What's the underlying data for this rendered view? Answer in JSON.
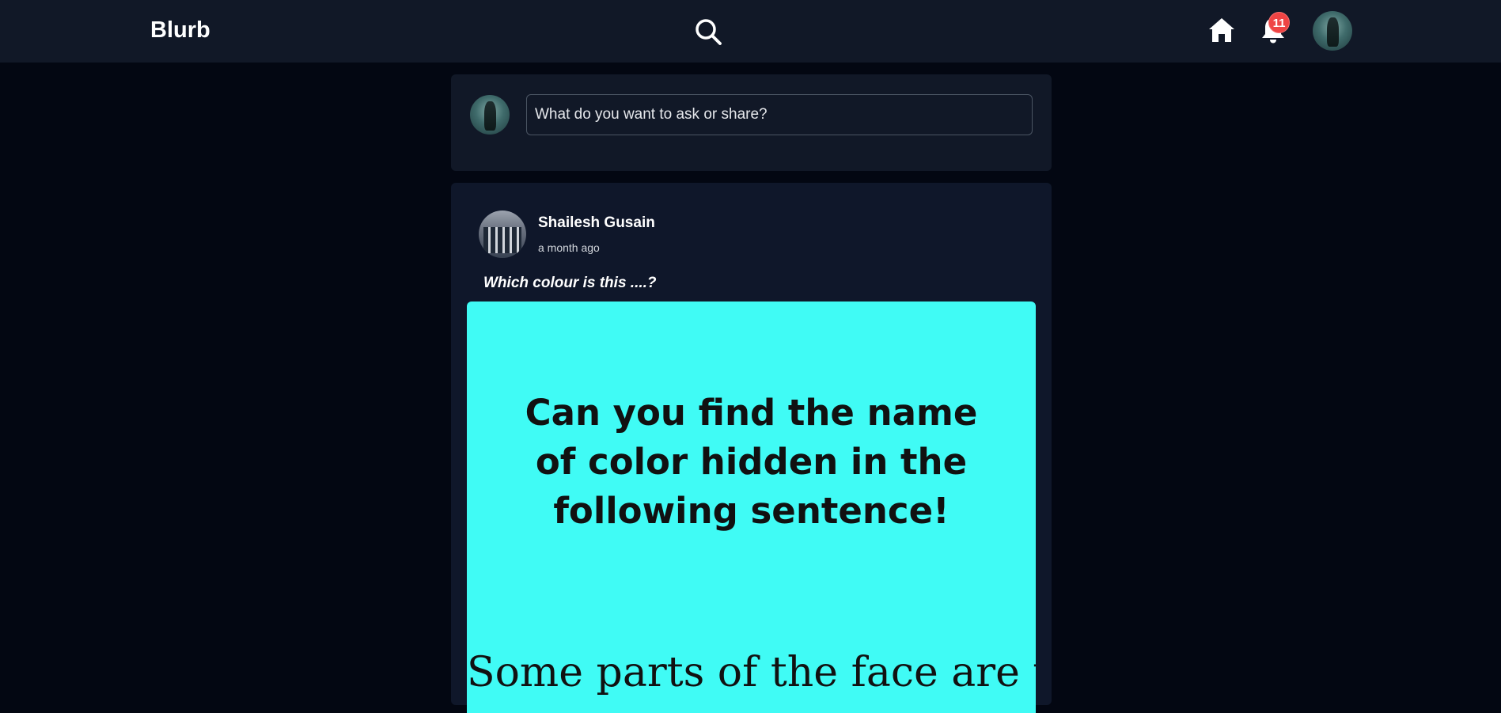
{
  "nav": {
    "logo": "Blurb",
    "notification_count": "11",
    "icons": [
      "search-icon",
      "home-icon",
      "bell-icon"
    ]
  },
  "composer": {
    "placeholder": "What do you want to ask or share?"
  },
  "post": {
    "author": "Shailesh Gusain",
    "time": "a month ago",
    "text": "Which colour is this ....?",
    "image": {
      "lines": [
        "Can you find the name",
        "of color hidden in the",
        "following sentence!"
      ],
      "partial_line": "Some parts of the face are the",
      "background": "#40fbf5"
    }
  },
  "colors": {
    "page_bg": "#030712",
    "nav_bg": "#111827",
    "card_bg": "#111827",
    "badge": "#ef4444"
  }
}
